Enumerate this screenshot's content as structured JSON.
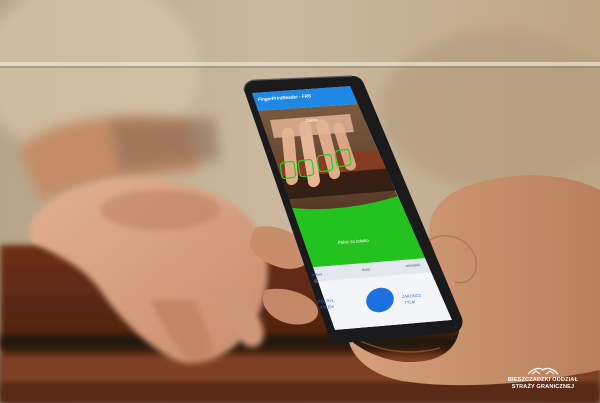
{
  "photo": {
    "subject": "hand holding smartphone scanning another hand's fingerprints",
    "colors": {
      "app_bar": "#1e88e5",
      "scan_overlay": "#24c21e",
      "capture_button": "#1e6fe0",
      "wood": "#7a3a20",
      "backdrop": "#c9b69b",
      "skin": "#d9a583"
    }
  },
  "app": {
    "title": "FingerPrintReader - FRS",
    "scan_label": "Dalibe",
    "status_text": "Palce za kolebo",
    "tabs": [
      "prawa",
      "lewa",
      "wsrodek"
    ],
    "left_action": "POCHYL\nTYŁEM",
    "right_action": "ZAKOŃCZ\nTYLM",
    "capture_icon": "circle-capture-icon"
  },
  "watermark": {
    "line1": "BIESZCZADZKI ODDZIAŁ",
    "line2": "STRAŻY GRANICZNEJ",
    "logo_icon": "border-guard-logo-icon"
  }
}
